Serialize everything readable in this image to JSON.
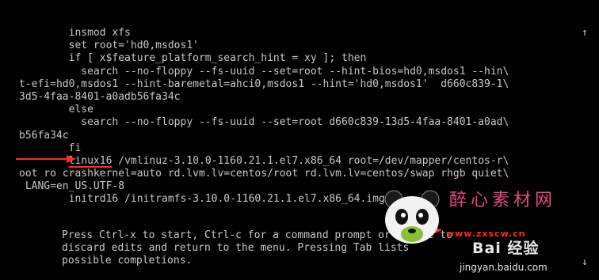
{
  "colors": {
    "background": "#000000",
    "text": "#c8c8c8",
    "annotation": "#ff2a2a",
    "watermark_pink": "#e84a7e"
  },
  "scrollbar": {
    "up_arrow": "↑",
    "down_arrow": "↓"
  },
  "editor": {
    "lines": [
      "        insmod xfs",
      "        set root='hd0,msdos1'",
      "        if [ x$feature_platform_search_hint = xy ]; then",
      "          search --no-floppy --fs-uuid --set=root --hint-bios=hd0,msdos1 --hin\\",
      "t-efi=hd0,msdos1 --hint-baremetal=ahci0,msdos1 --hint='hd0,msdos1'  d660c839-1\\",
      "3d5-4faa-8401-a0adb56fa34c",
      "        else",
      "          search --no-floppy --fs-uuid --set=root d660c839-13d5-4faa-8401-a0ad\\",
      "b56fa34c",
      "        fi"
    ],
    "linux_indent": "        ",
    "linux_keyword": "linux16",
    "linux_rest": " /vmlinuz-3.10.0-1160.21.1.el7.x86_64 root=/dev/mapper/centos-r\\",
    "lines_after": [
      "oot ro crashkernel=auto rd.lvm.lv=centos/root rd.lvm.lv=centos/swap rhgb quiet\\",
      " LANG=en_US.UTF-8",
      "        initrd16 /initramfs-3.10.0-1160.21.1.el7.x86_64.img"
    ]
  },
  "help": {
    "lines": [
      "Press Ctrl-x to start, Ctrl-c for a command prompt or Escape to",
      "discard edits and return to the menu. Pressing Tab lists",
      "possible completions."
    ]
  },
  "watermark": {
    "title": "醉心素材网",
    "url": "www.zxscw.cn",
    "baidu_logo": "Bai 经验",
    "footer": "jingyan.baidu.com"
  }
}
